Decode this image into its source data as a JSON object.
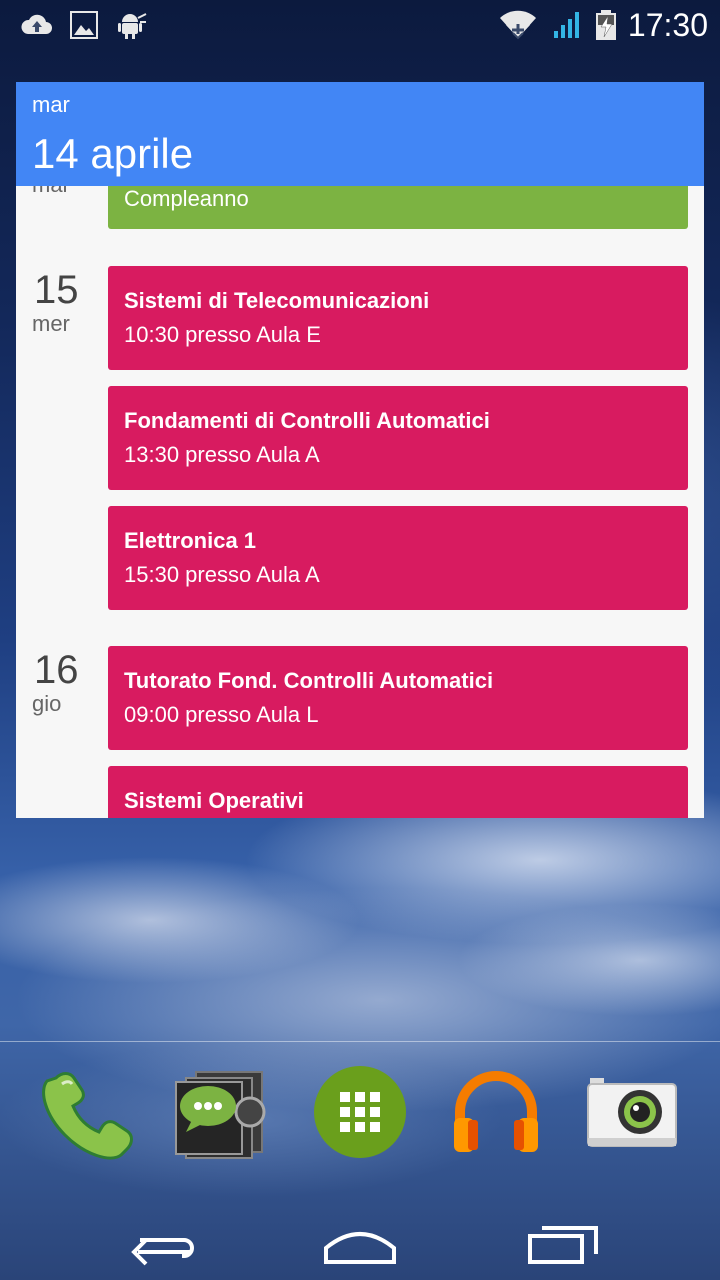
{
  "status_bar": {
    "time": "17:30",
    "icons": [
      "cloud-upload-icon",
      "gallery-icon",
      "android-debug-icon",
      "wifi-icon",
      "signal-icon",
      "battery-charging-icon"
    ]
  },
  "widget": {
    "header": {
      "day": "mar",
      "date": "14 aprile"
    },
    "days": [
      {
        "number": "",
        "name": "mar",
        "events": [
          {
            "title": "Compleanno",
            "subtitle": "",
            "color": "#7cb342"
          }
        ]
      },
      {
        "number": "15",
        "name": "mer",
        "events": [
          {
            "title": "Sistemi di Telecomunicazioni",
            "subtitle": "10:30 presso Aula E",
            "color": "#d81b60"
          },
          {
            "title": "Fondamenti di Controlli Automatici",
            "subtitle": "13:30 presso Aula A",
            "color": "#d81b60"
          },
          {
            "title": "Elettronica 1",
            "subtitle": "15:30 presso Aula A",
            "color": "#d81b60"
          }
        ]
      },
      {
        "number": "16",
        "name": "gio",
        "events": [
          {
            "title": "Tutorato Fond. Controlli Automatici",
            "subtitle": "09:00 presso Aula L",
            "color": "#d81b60"
          },
          {
            "title": "Sistemi Operativi",
            "subtitle": "",
            "color": "#d81b60"
          }
        ]
      }
    ]
  },
  "dock": {
    "apps": [
      "phone-icon",
      "messaging-icon",
      "app-drawer-icon",
      "play-music-icon",
      "camera-icon"
    ]
  },
  "nav": {
    "buttons": [
      "back-icon",
      "home-icon",
      "recents-icon"
    ]
  },
  "colors": {
    "header_blue": "#4286f5",
    "event_pink": "#d81b60",
    "event_green": "#7cb342"
  }
}
